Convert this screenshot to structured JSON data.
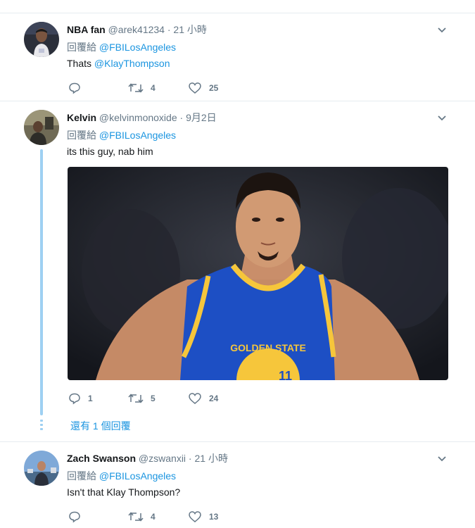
{
  "tweets": [
    {
      "name": "NBA fan",
      "handle": "@arek41234",
      "time": " · 21 小時",
      "reply_prefix": "回覆給 ",
      "reply_to": "@FBILosAngeles",
      "text_prefix": "Thats ",
      "text_link": "@KlayThompson",
      "reply_count": "",
      "retweet_count": "4",
      "like_count": "25"
    },
    {
      "name": "Kelvin",
      "handle": "@kelvinmonoxide",
      "time": " · 9月2日",
      "reply_prefix": "回覆給 ",
      "reply_to": "@FBILosAngeles",
      "text": "its this guy, nab him",
      "jersey_text": "GOLDEN STATE",
      "jersey_number": "11",
      "reply_count": "1",
      "retweet_count": "5",
      "like_count": "24",
      "more_replies": "還有 1 個回覆"
    },
    {
      "name": "Zach Swanson",
      "handle": "@zswanxii",
      "time": " · 21 小時",
      "reply_prefix": "回覆給 ",
      "reply_to": "@FBILosAngeles",
      "text": "Isn't that Klay Thompson?",
      "reply_count": "",
      "retweet_count": "4",
      "like_count": "13"
    }
  ],
  "icons": {
    "reply": "reply-icon",
    "retweet": "retweet-icon",
    "like": "heart-icon",
    "more": "chevron-down-icon"
  },
  "colors": {
    "link": "#1b95e0",
    "muted": "#657786",
    "thread": "#9ed0f2",
    "jersey_blue": "#1d4fc4",
    "jersey_gold": "#f6c63b"
  }
}
